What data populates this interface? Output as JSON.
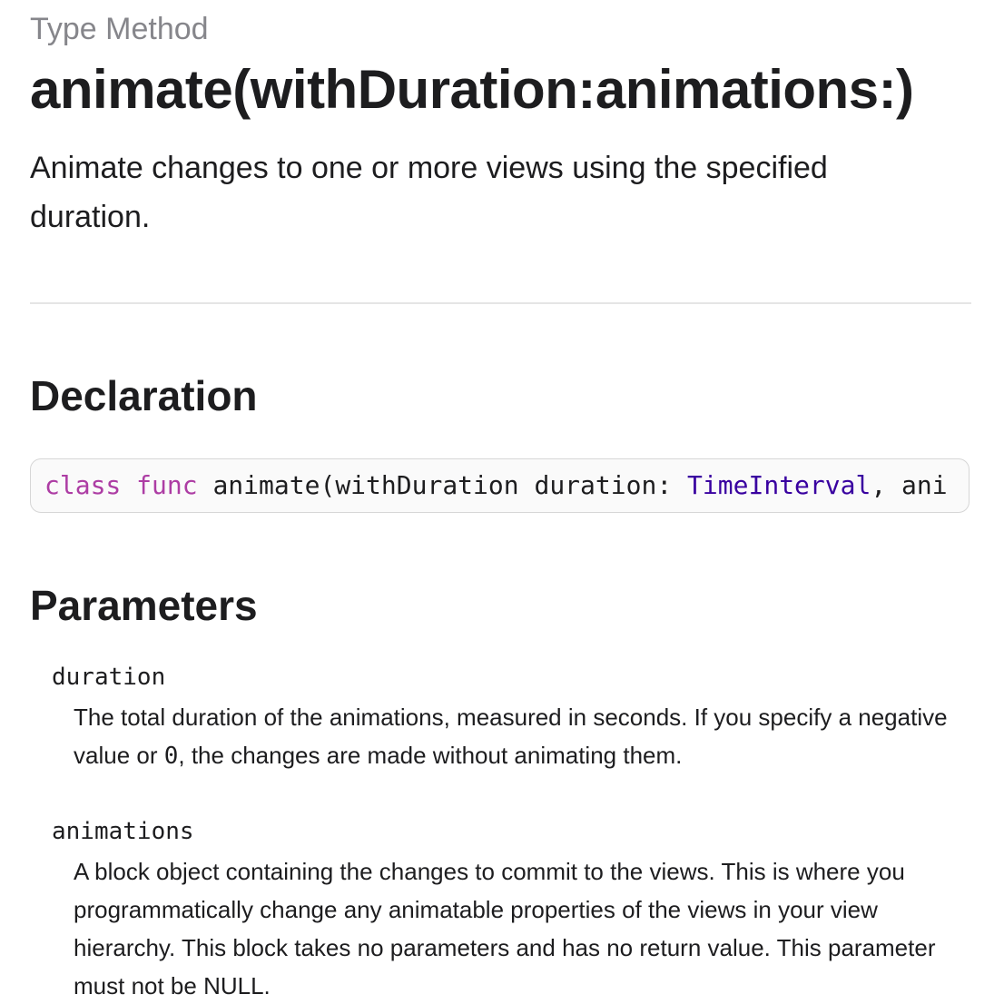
{
  "header": {
    "eyebrow": "Type Method",
    "title": "animate(withDuration:animations:)",
    "abstract": "Animate changes to one or more views using the specified duration."
  },
  "declaration": {
    "heading": "Declaration",
    "code": {
      "kw_class": "class",
      "kw_func": "func",
      "name_part": "animate(withDuration duration: ",
      "type": "TimeInterval",
      "rest": ", ani"
    }
  },
  "parameters": {
    "heading": "Parameters",
    "items": [
      {
        "name": "duration",
        "desc_before": "The total duration of the animations, measured in seconds. If you specify a negative value or ",
        "desc_code": "0",
        "desc_after": ", the changes are made without animating them."
      },
      {
        "name": "animations",
        "desc": "A block object containing the changes to commit to the views. This is where you programmatically change any animatable properties of the views in your view hierarchy. This block takes no parameters and has no return value. This parameter must not be NULL."
      }
    ]
  },
  "colors": {
    "keyword": "#ad3da4",
    "type": "#3900a0",
    "eyebrow": "#86868b",
    "text": "#1d1d1f"
  }
}
